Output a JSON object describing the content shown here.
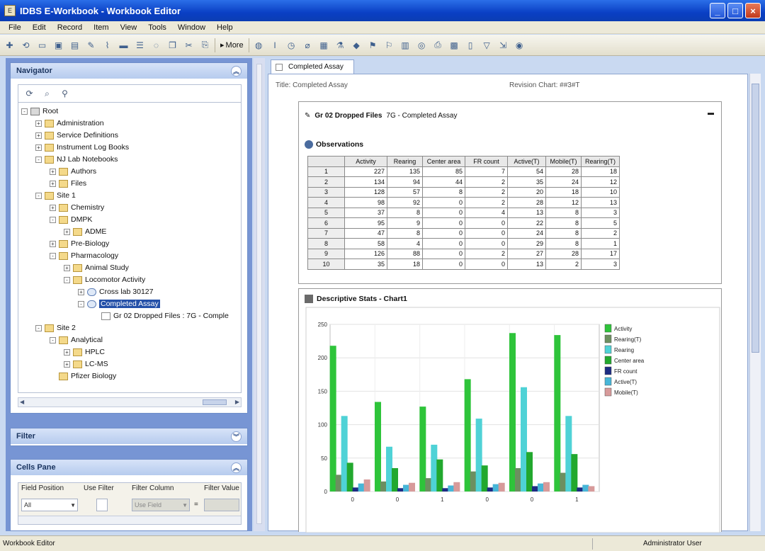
{
  "window": {
    "title": "IDBS E-Workbook - Workbook Editor"
  },
  "menu": [
    "File",
    "Edit",
    "Record",
    "Item",
    "View",
    "Tools",
    "Window",
    "Help"
  ],
  "toolbar": {
    "more_label": "More"
  },
  "navigator": {
    "title": "Navigator",
    "tree": [
      {
        "label": "Root",
        "level": 0,
        "expand": "-",
        "icon": "root"
      },
      {
        "label": "Administration",
        "level": 1,
        "expand": "+",
        "icon": "folder"
      },
      {
        "label": "Service Definitions",
        "level": 1,
        "expand": "+",
        "icon": "folder"
      },
      {
        "label": "Instrument Log Books",
        "level": 1,
        "expand": "+",
        "icon": "folder"
      },
      {
        "label": "NJ Lab Notebooks",
        "level": 1,
        "expand": "-",
        "icon": "folder"
      },
      {
        "label": "Authors",
        "level": 2,
        "expand": "+",
        "icon": "folder"
      },
      {
        "label": "Files",
        "level": 2,
        "expand": "+",
        "icon": "folder"
      },
      {
        "label": "Site 1",
        "level": 1,
        "expand": "-",
        "icon": "folder"
      },
      {
        "label": "Chemistry",
        "level": 2,
        "expand": "+",
        "icon": "folder"
      },
      {
        "label": "DMPK",
        "level": 2,
        "expand": "-",
        "icon": "folder"
      },
      {
        "label": "ADME",
        "level": 3,
        "expand": "+",
        "icon": "folder"
      },
      {
        "label": "Pre-Biology",
        "level": 2,
        "expand": "+",
        "icon": "folder"
      },
      {
        "label": "Pharmacology",
        "level": 2,
        "expand": "-",
        "icon": "folder"
      },
      {
        "label": "Animal Study",
        "level": 3,
        "expand": "+",
        "icon": "folder"
      },
      {
        "label": "Locomotor Activity",
        "level": 3,
        "expand": "-",
        "icon": "folder"
      },
      {
        "label": "Cross lab 30127",
        "level": 4,
        "expand": "+",
        "icon": "circle"
      },
      {
        "label": "Completed Assay",
        "level": 4,
        "expand": "-",
        "icon": "circle",
        "selected": true
      },
      {
        "label": "Gr 02 Dropped Files : 7G - Comple",
        "level": 5,
        "expand": "",
        "icon": "doc"
      },
      {
        "label": "Site 2",
        "level": 1,
        "expand": "-",
        "icon": "folder"
      },
      {
        "label": "Analytical",
        "level": 2,
        "expand": "-",
        "icon": "folder"
      },
      {
        "label": "HPLC",
        "level": 3,
        "expand": "+",
        "icon": "folder"
      },
      {
        "label": "LC-MS",
        "level": 3,
        "expand": "+",
        "icon": "folder"
      },
      {
        "label": "Pfizer Biology",
        "level": 2,
        "expand": "",
        "icon": "folder"
      }
    ]
  },
  "filter": {
    "title": "Filter"
  },
  "column_filter": {
    "title": "Cells Pane",
    "headers": [
      "Field Position",
      "Use Filter",
      "Filter Column",
      "Filter Value"
    ],
    "field_value": "All",
    "column_value": "Use Field"
  },
  "document": {
    "tab_label": "Completed Assay",
    "title_text": "Title: Completed Assay",
    "revision_text": "Revision Chart: ##3#T",
    "section1_title": "Gr 02 Dropped Files",
    "section1_subtitle": "7G - Completed Assay",
    "observations_label": "Observations",
    "table": {
      "headers": [
        "",
        "Activity",
        "Rearing",
        "Center area",
        "FR count",
        "Active(T)",
        "Mobile(T)",
        "Rearing(T)"
      ],
      "rows": [
        [
          "1",
          "227",
          "135",
          "85",
          "7",
          "54",
          "28",
          "18"
        ],
        [
          "2",
          "134",
          "94",
          "44",
          "2",
          "35",
          "24",
          "12"
        ],
        [
          "3",
          "128",
          "57",
          "8",
          "2",
          "20",
          "18",
          "10"
        ],
        [
          "4",
          "98",
          "92",
          "0",
          "2",
          "28",
          "12",
          "13"
        ],
        [
          "5",
          "37",
          "8",
          "0",
          "4",
          "13",
          "8",
          "3"
        ],
        [
          "6",
          "95",
          "9",
          "0",
          "0",
          "22",
          "8",
          "5"
        ],
        [
          "7",
          "47",
          "8",
          "0",
          "0",
          "24",
          "8",
          "2"
        ],
        [
          "8",
          "58",
          "4",
          "0",
          "0",
          "29",
          "8",
          "1"
        ],
        [
          "9",
          "126",
          "88",
          "0",
          "2",
          "27",
          "28",
          "17"
        ],
        [
          "10",
          "35",
          "18",
          "0",
          "0",
          "13",
          "2",
          "3"
        ]
      ]
    },
    "section2_title": "Descriptive Stats - Chart1"
  },
  "chart_data": {
    "type": "bar",
    "categories": [
      "0",
      "0",
      "1",
      "0",
      "0",
      "1"
    ],
    "ylim": [
      0,
      250
    ],
    "yticks": [
      "0",
      "50",
      "100",
      "150",
      "200",
      "250"
    ],
    "grid": true,
    "legend_position": "top-right",
    "series": [
      {
        "name": "Activity",
        "color": "#2ec43a",
        "values": [
          218,
          134,
          127,
          168,
          237,
          234
        ]
      },
      {
        "name": "Rearing(T)",
        "color": "#6c8f60",
        "values": [
          25,
          15,
          20,
          30,
          35,
          28
        ]
      },
      {
        "name": "Rearing",
        "color": "#4fd2d6",
        "values": [
          113,
          67,
          70,
          109,
          156,
          113
        ]
      },
      {
        "name": "Center area",
        "color": "#22a82e",
        "values": [
          43,
          35,
          48,
          39,
          59,
          56
        ]
      },
      {
        "name": "FR count",
        "color": "#1c2b83",
        "values": [
          6,
          5,
          5,
          6,
          8,
          6
        ]
      },
      {
        "name": "Active(T)",
        "color": "#47b6d8",
        "values": [
          12,
          10,
          9,
          11,
          12,
          10
        ]
      },
      {
        "name": "Mobile(T)",
        "color": "#d79a9a",
        "values": [
          18,
          13,
          14,
          13,
          14,
          8
        ]
      }
    ]
  },
  "status": {
    "left": "Workbook Editor",
    "right": "Administrator User"
  }
}
